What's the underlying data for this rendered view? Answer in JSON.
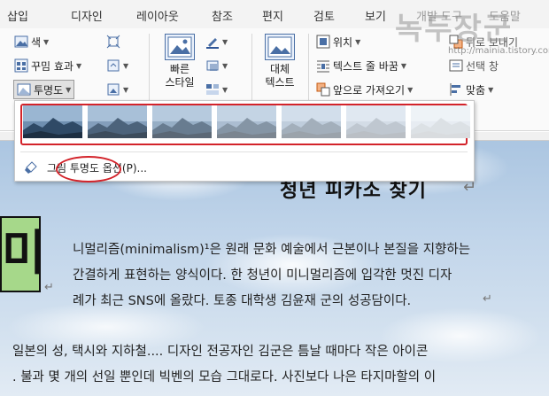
{
  "tabs": [
    "삽입",
    "디자인",
    "레이아웃",
    "참조",
    "편지",
    "검토",
    "보기",
    "개발 도구",
    "도움말"
  ],
  "ribbon": {
    "adjust": {
      "color": "색",
      "artistic": "꾸밈 효과",
      "transparency": "투명도"
    },
    "styles": {
      "quick_styles_line1": "빠른",
      "quick_styles_line2": "스타일"
    },
    "accessibility": {
      "alt_text_line1": "대체",
      "alt_text_line2": "텍스트"
    },
    "arrange": {
      "position": "위치",
      "wrap_text": "텍스트 줄 바꿈",
      "bring_forward": "앞으로 가져오기",
      "send_backward": "뒤로 보내기",
      "selection_pane": "선택 창",
      "align": "맞춤"
    }
  },
  "popup": {
    "thumbnail_count": 7,
    "option": "그림 투명도 옵션(P)..."
  },
  "document": {
    "title": "청년 피카소 찾기",
    "box_letter": "미",
    "lines": [
      "니멀리즘(minimalism)¹은 원래 문화 예술에서 근본이나 본질을 지향하는",
      "간결하게 표현하는 양식이다. 한 청년이 미니멀리즘에 입각한 멋진 디자",
      "례가 최근 SNS에 올랐다. 토종 대학생 김윤재 군의 성공담이다.",
      "일본의 성, 택시와 지하철.... 디자인 전공자인 김군은 틈날 때마다  작은 아이콘",
      ". 불과 몇 개의 선일 뿐인데 빅벤의 모습 그대로다. 사진보다 나은 타지마할의 이"
    ]
  },
  "watermark": {
    "title": "녹두장군",
    "url": "http://mainia.tistory.com"
  },
  "colors": {
    "highlight": "#d3232a",
    "shape_fill": "#a6d88a"
  }
}
